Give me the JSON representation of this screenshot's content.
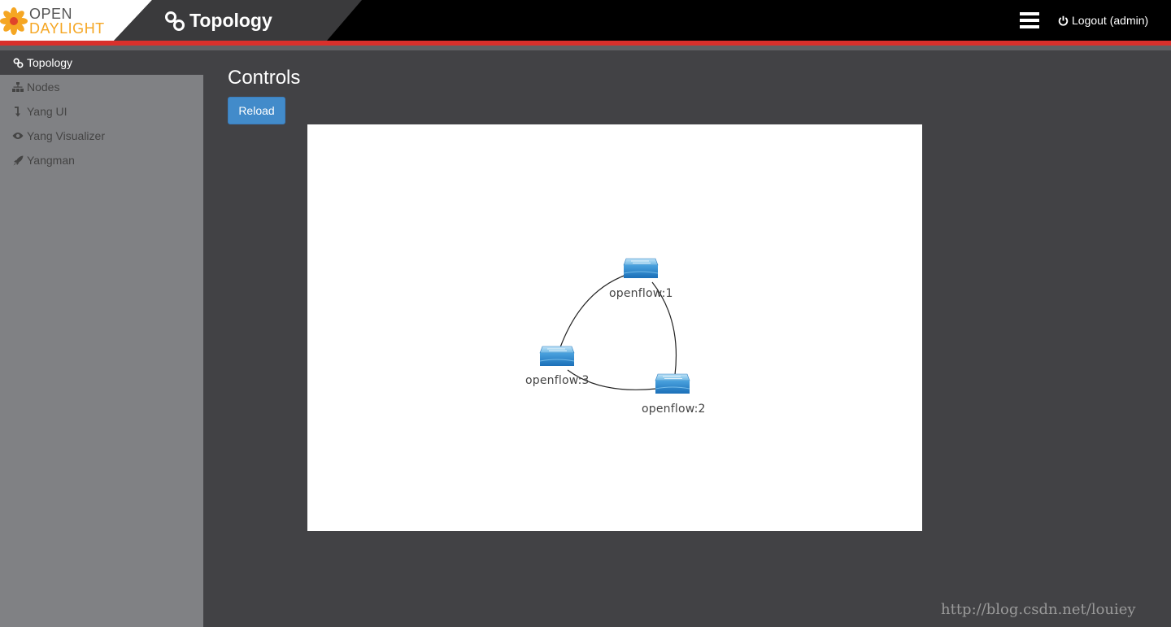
{
  "header": {
    "logo_line1": "OPEN",
    "logo_line2": "DAYLIGHT",
    "page_title": "Topology",
    "logout_label": "Logout (admin)",
    "colors": {
      "accent_red": "#d9302c",
      "logo_orange": "#f5a623"
    }
  },
  "sidebar": {
    "items": [
      {
        "label": "Topology",
        "icon": "link-icon",
        "active": true
      },
      {
        "label": "Nodes",
        "icon": "sitemap-icon",
        "active": false
      },
      {
        "label": "Yang UI",
        "icon": "level-down-icon",
        "active": false
      },
      {
        "label": "Yang Visualizer",
        "icon": "eye-icon",
        "active": false
      },
      {
        "label": "Yangman",
        "icon": "rocket-icon",
        "active": false
      }
    ]
  },
  "main": {
    "controls_title": "Controls",
    "reload_label": "Reload",
    "topology": {
      "nodes": [
        {
          "id": "openflow:1",
          "label": "openflow:1"
        },
        {
          "id": "openflow:2",
          "label": "openflow:2"
        },
        {
          "id": "openflow:3",
          "label": "openflow:3"
        }
      ],
      "links": [
        [
          "openflow:1",
          "openflow:2"
        ],
        [
          "openflow:2",
          "openflow:3"
        ],
        [
          "openflow:3",
          "openflow:1"
        ]
      ]
    }
  },
  "watermark": "http://blog.csdn.net/louiey"
}
